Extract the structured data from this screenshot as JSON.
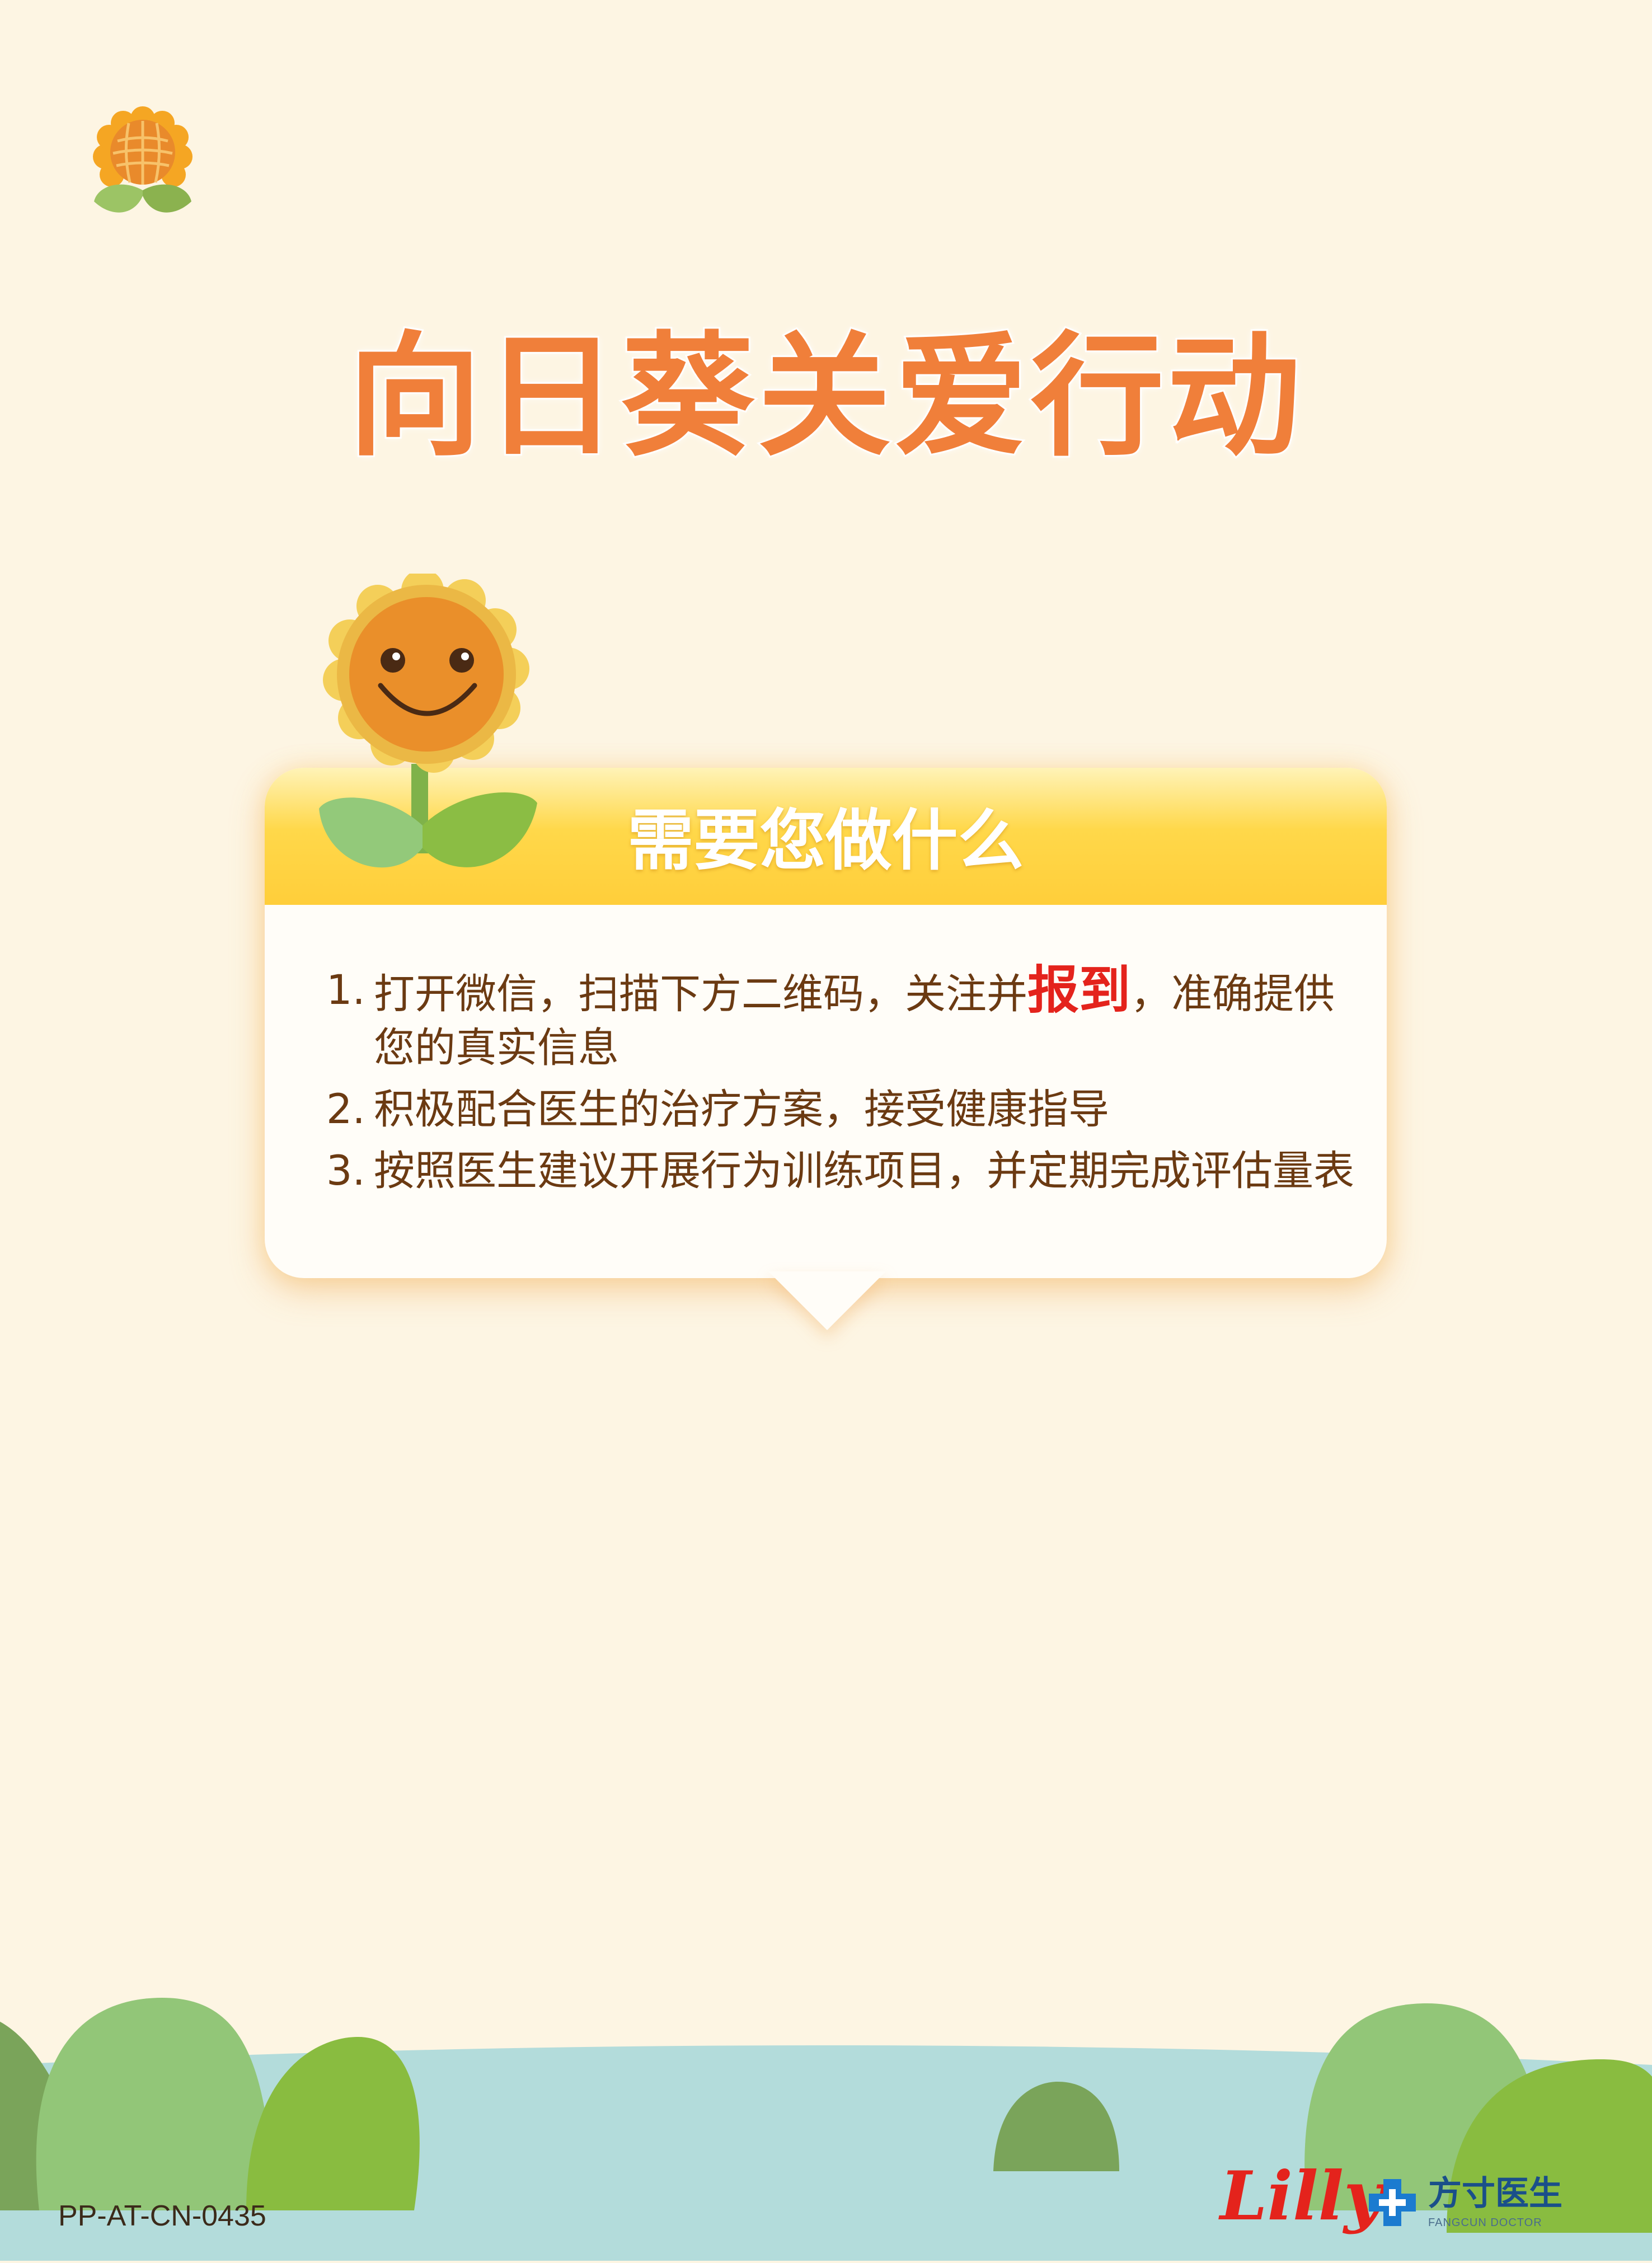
{
  "title": "向日葵关爱行动",
  "card": {
    "header": "需要您做什么",
    "steps": [
      {
        "num": "1.",
        "before": "打开微信，扫描下方二维码，关注并",
        "highlight": "报到",
        "after": "，准确提供您的真实信息"
      },
      {
        "num": "2.",
        "text": "积极配合医生的治疗方案，接受健康指导"
      },
      {
        "num": "3.",
        "text": "按照医生建议开展行为训练项目，并定期完成评估量表"
      }
    ]
  },
  "footer": {
    "code": "PP-AT-CN-0435",
    "lilly": "Lilly",
    "fangcun_name": "方寸医生",
    "fangcun_sub": "FANGCUN DOCTOR"
  },
  "colors": {
    "background": "#fdf5e3",
    "title": "#f07f3a",
    "step_text": "#6b3a12",
    "highlight": "#e4231c",
    "header_yellow": "#ffd84a",
    "lilly_red": "#e4231c",
    "fangcun_blue": "#1a4f8a"
  }
}
